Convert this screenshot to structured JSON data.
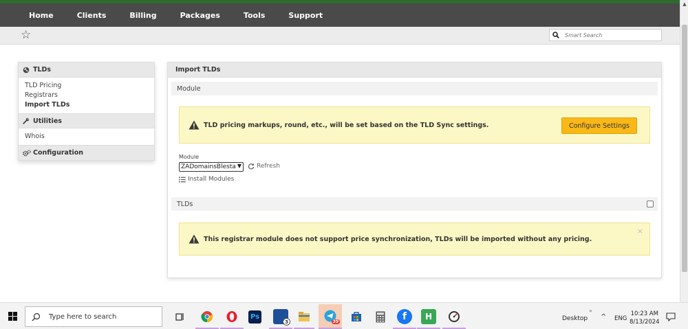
{
  "nav": {
    "items": [
      "Home",
      "Clients",
      "Billing",
      "Packages",
      "Tools",
      "Support"
    ]
  },
  "search": {
    "placeholder": "Smart Search"
  },
  "sidebar": {
    "tlds": {
      "title": "TLDs",
      "links": [
        "TLD Pricing",
        "Registrars",
        "Import TLDs"
      ],
      "active": "Import TLDs"
    },
    "utilities": {
      "title": "Utilities",
      "links": [
        "Whois"
      ]
    },
    "configuration": {
      "title": "Configuration"
    }
  },
  "panel": {
    "title": "Import TLDs",
    "module_section": "Module",
    "alert_pricing": "TLD pricing markups, round, etc., will be set based on the TLD Sync settings.",
    "configure_button": "Configure Settings",
    "module_label": "Module",
    "module_value": "ZADomainsBlesta",
    "refresh_label": "Refresh",
    "install_label": "Install Modules",
    "tlds_section": "TLDs",
    "alert_sync": "This registrar module does not support price synchronization, TLDs will be imported without any pricing.",
    "close_symbol": "×"
  },
  "taskbar": {
    "search_placeholder": "Type here to search",
    "icons": [
      {
        "name": "task-view-icon",
        "label": ""
      },
      {
        "name": "chrome-icon",
        "label": ""
      },
      {
        "name": "opera-icon",
        "label": ""
      },
      {
        "name": "photoshop-icon",
        "label": "Ps"
      },
      {
        "name": "mail-icon",
        "label": "3"
      },
      {
        "name": "file-explorer-icon",
        "label": ""
      },
      {
        "name": "telegram-icon",
        "label": "39"
      },
      {
        "name": "store-icon",
        "label": ""
      },
      {
        "name": "calculator-icon",
        "label": ""
      },
      {
        "name": "facebook-icon",
        "label": "f"
      },
      {
        "name": "hotspot-icon",
        "label": "H"
      },
      {
        "name": "speedometer-icon",
        "label": ""
      }
    ],
    "desktop_label": "Desktop",
    "language": "ENG",
    "time": "10:23 AM",
    "date": "8/13/2024"
  },
  "colors": {
    "nav_bg": "#4a4a4a",
    "accent_button": "#f9b818",
    "alert_bg": "#fcf8c6"
  }
}
